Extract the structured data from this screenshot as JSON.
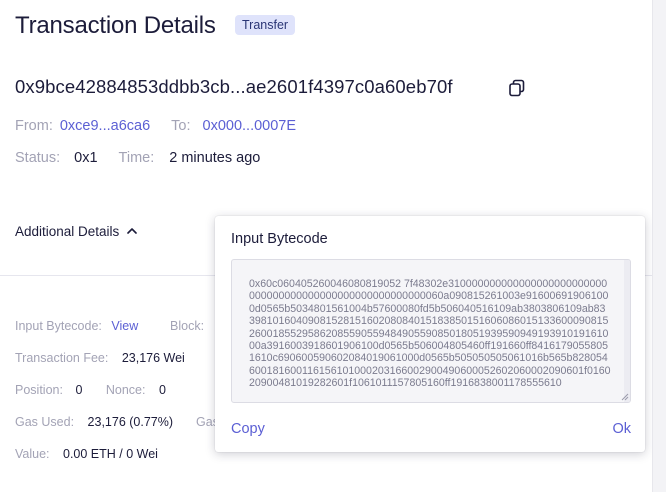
{
  "header": {
    "title": "Transaction Details",
    "badge": "Transfer"
  },
  "transaction": {
    "hash": "0x9bce42884853ddbb3cb...ae2601f4397c0a60eb70f",
    "from_label": "From:",
    "from_value": "0xce9...a6ca6",
    "to_label": "To:",
    "to_value": "0x000...0007E",
    "status_label": "Status:",
    "status_value": "0x1",
    "time_label": "Time:",
    "time_value": "2 minutes ago"
  },
  "additional": {
    "label": "Additional Details",
    "expanded": true
  },
  "details": {
    "input_bytecode_label": "Input Bytecode:",
    "input_bytecode_link": "View",
    "block_label": "Block:",
    "fee_label": "Transaction Fee:",
    "fee_value": "23,176 Wei",
    "position_label": "Position:",
    "position_value": "0",
    "nonce_label": "Nonce:",
    "nonce_value": "0",
    "gas_used_label": "Gas Used:",
    "gas_used_value": "23,176 (0.77%)",
    "gas_cut_label": "Gas",
    "value_label": "Value:",
    "value_value": "0.00 ETH / 0 Wei"
  },
  "popover": {
    "title": "Input Bytecode",
    "bytecode": "0x60c060405260046080819052 7f48302e310000000000000000000000000000000000000000000000000000000060a090815261003e916006919061000d0565b5034801561004b57600080fd5b506040516109ab3803806109ab833981016040908152815160208084015183850151606086015133600090815260018552958620855905594849055908501805193959094919391019161000a3916003918601906100d0565b506004805460ff191660ff84161790558051610c690600590602084019061000d0565b505050505061016b565b828054600181600116156101000203166002900490600052602060002090601f016020900481019282601f1061011157805160ff1916838001178555610",
    "copy_label": "Copy",
    "ok_label": "Ok"
  },
  "colors": {
    "accent": "#5b5fd4",
    "badge_bg": "#dfe3fb",
    "label_gray": "#a3a3b5",
    "text_dark": "#1c1c3a"
  },
  "icons": {
    "copy": "copy-icon",
    "chevron": "chevron-up-icon"
  }
}
